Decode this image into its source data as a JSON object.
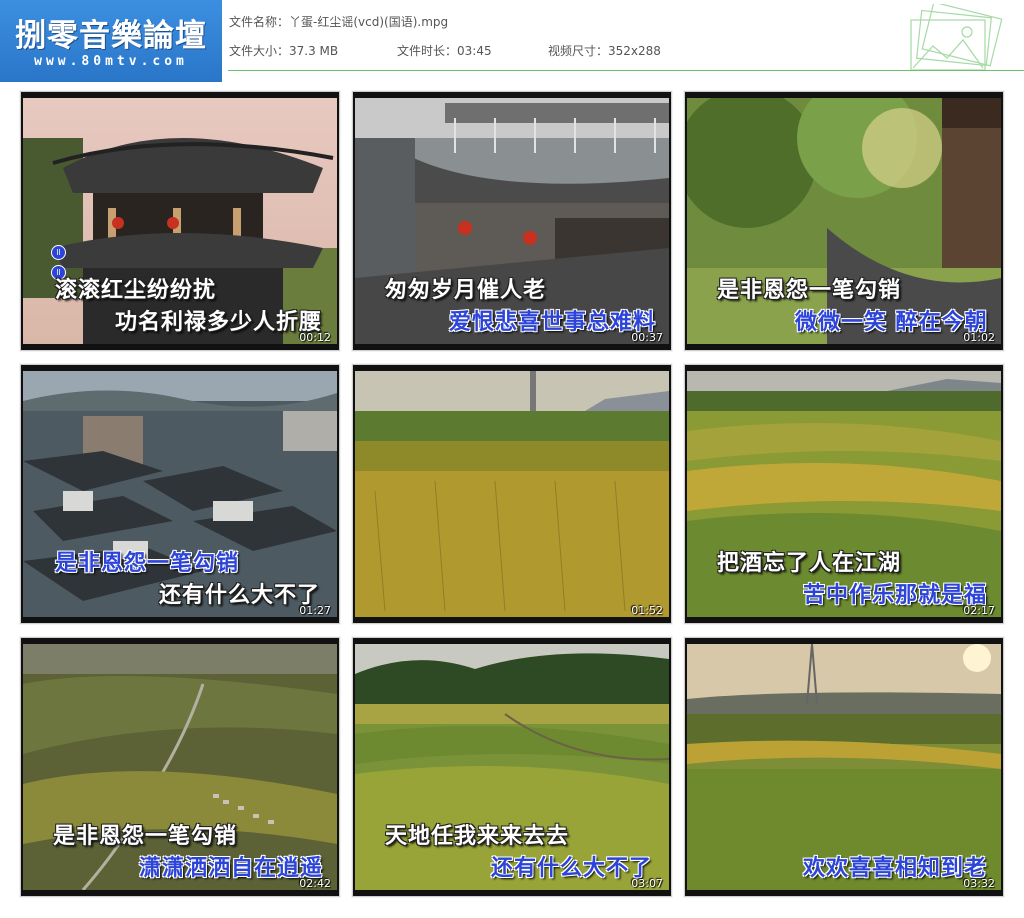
{
  "logo": {
    "title": "捌零音樂論壇",
    "url": "www.80mtv.com"
  },
  "file_info": {
    "name_label": "文件名称：",
    "name_value": "丫蛋-红尘谣(vcd)(国语).mpg",
    "size_label": "文件大小：",
    "size_value": "37.3 MB",
    "duration_label": "文件时长：",
    "duration_value": "03:45",
    "dimensions_label": "视频尺寸：",
    "dimensions_value": "352x288"
  },
  "accent_colors": {
    "logo_bg": "#2a76c9",
    "header_line": "#6cc06c",
    "lyric_blue": "#2d44d8"
  },
  "thumbnails": [
    {
      "time": "00:12",
      "line1": "滚滚红尘纷纷扰",
      "line2": "功名利禄多少人折腰",
      "badge": "ll"
    },
    {
      "time": "00:37",
      "line1": "匆匆岁月催人老",
      "line2": "爱恨悲喜世事总难料"
    },
    {
      "time": "01:02",
      "line1": "是非恩怨一笔勾销",
      "line2": "微微一笑 醉在今朝"
    },
    {
      "time": "01:27",
      "line1": "是非恩怨一笔勾销",
      "line2": "还有什么大不了"
    },
    {
      "time": "01:52",
      "line1": "",
      "line2": ""
    },
    {
      "time": "02:17",
      "line1": "把酒忘了人在江湖",
      "line2": "苦中作乐那就是福"
    },
    {
      "time": "02:42",
      "line1": "是非恩怨一笔勾销",
      "line2": "潇潇洒洒自在逍遥"
    },
    {
      "time": "03:07",
      "line1": "天地任我来来去去",
      "line2": "还有什么大不了"
    },
    {
      "time": "03:32",
      "line1": "",
      "line2": "欢欢喜喜相知到老"
    }
  ]
}
